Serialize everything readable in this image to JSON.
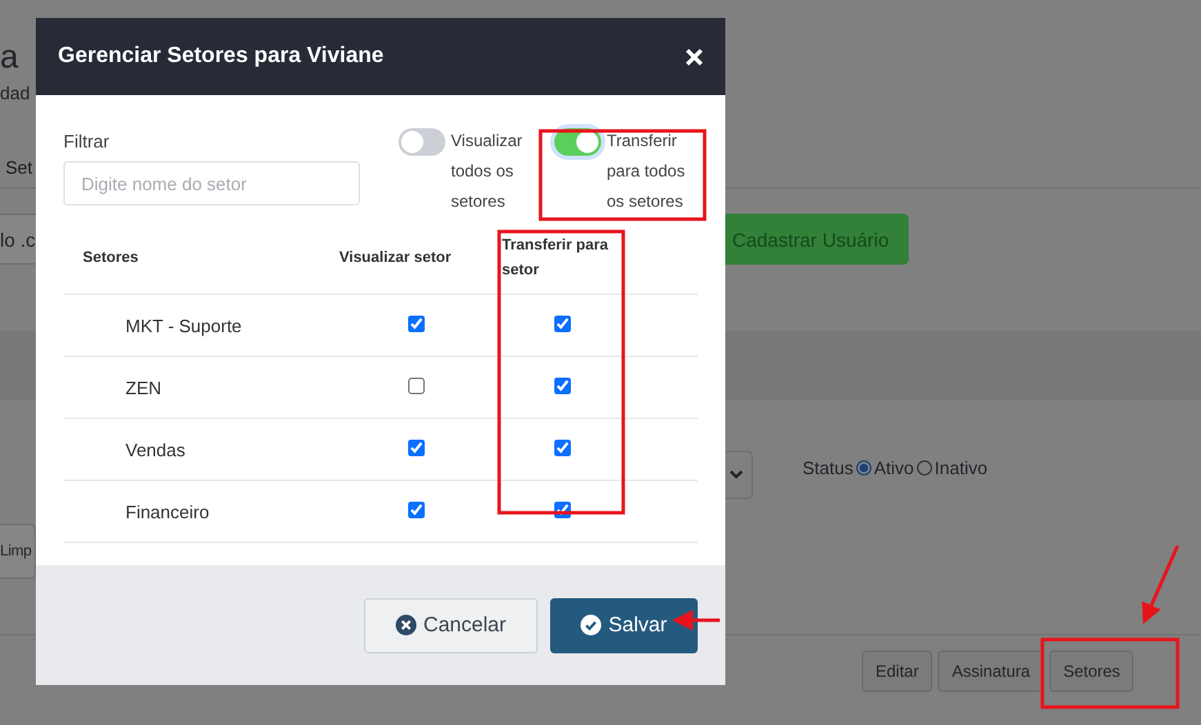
{
  "background": {
    "page_title": "a",
    "subtitle": "dad",
    "tab": "Set",
    "left_button": "lo .c",
    "add_user_button": "Cadastrar Usuário",
    "status": {
      "label": "Status",
      "options": [
        {
          "label": "Ativo",
          "selected": true
        },
        {
          "label": "Inativo",
          "selected": false
        }
      ]
    },
    "clear_button": "Limp",
    "actions": [
      "Editar",
      "Assinatura",
      "Setores"
    ]
  },
  "dialog": {
    "title": "Gerenciar Setores para Viviane",
    "filter": {
      "label": "Filtrar",
      "placeholder": "Digite nome do setor"
    },
    "toggles": [
      {
        "label": "Visualizar todos os setores",
        "on": false
      },
      {
        "label": "Transferir para todos os setores",
        "on": true
      }
    ],
    "table": {
      "columns": [
        "Setores",
        "Visualizar setor",
        "Transferir para setor"
      ],
      "rows": [
        {
          "name": "MKT - Suporte",
          "view": true,
          "transfer": true
        },
        {
          "name": "ZEN",
          "view": false,
          "transfer": true
        },
        {
          "name": "Vendas",
          "view": true,
          "transfer": true
        },
        {
          "name": "Financeiro",
          "view": true,
          "transfer": true
        }
      ]
    },
    "buttons": [
      {
        "label": "Cancelar",
        "kind": "secondary"
      },
      {
        "label": "Salvar",
        "kind": "primary"
      }
    ]
  }
}
